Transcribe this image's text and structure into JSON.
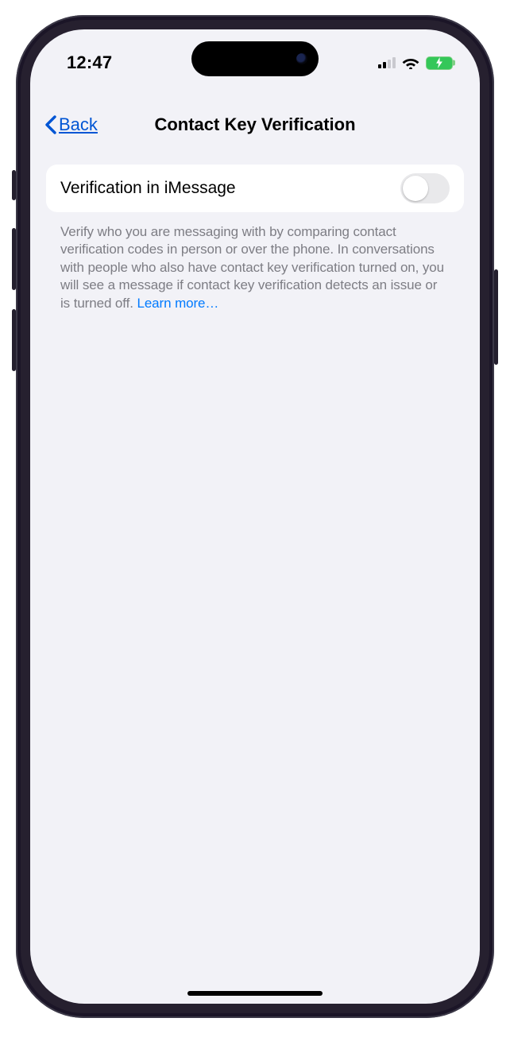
{
  "status_bar": {
    "time": "12:47"
  },
  "nav": {
    "back_label": "Back",
    "title": "Contact Key Verification"
  },
  "settings": {
    "verification_label": "Verification in iMessage",
    "verification_on": false
  },
  "footer": {
    "description": "Verify who you are messaging with by comparing contact verification codes in person or over the phone. In conversations with people who also have contact key verification turned on, you will see a message if contact key verification detects an issue or is turned off.",
    "learn_more_label": "Learn more…"
  }
}
